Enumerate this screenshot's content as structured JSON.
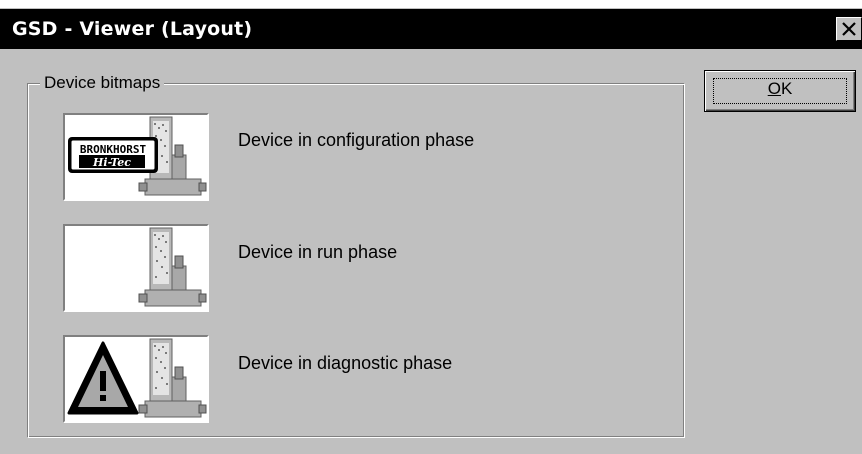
{
  "window": {
    "title": "GSD - Viewer (Layout)",
    "close_icon": "close-x-icon"
  },
  "group": {
    "label": "Device bitmaps"
  },
  "rows": [
    {
      "label": "Device in configuration phase",
      "bitmap": "bronkhorst-device-icon",
      "badge_text": [
        "BRONKHORST",
        "Hi-Tec"
      ]
    },
    {
      "label": "Device in run phase",
      "bitmap": "device-icon"
    },
    {
      "label": "Device in diagnostic phase",
      "bitmap": "warning-device-icon",
      "badge_text": "!"
    }
  ],
  "buttons": {
    "ok_mnemonic": "O",
    "ok_rest": "K"
  },
  "colors": {
    "face": "#c0c0c0",
    "titlebar": "#000000",
    "title_text": "#ffffff",
    "bitmap_bg": "#ffffff"
  }
}
